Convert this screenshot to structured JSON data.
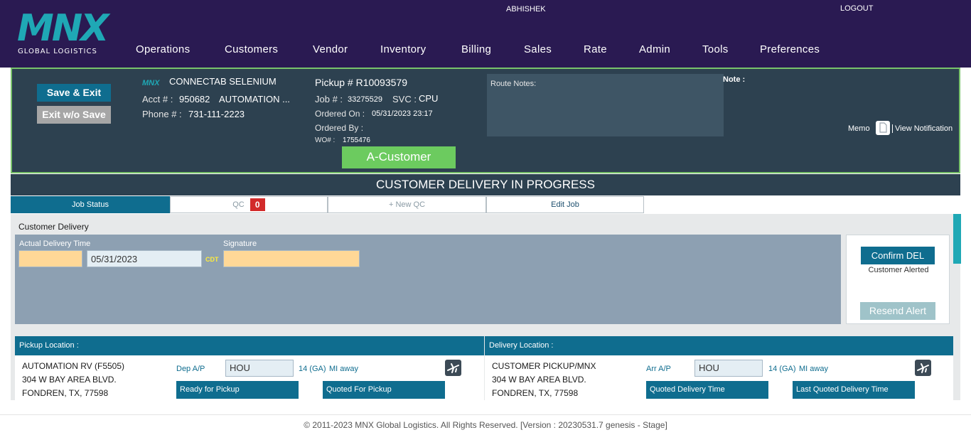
{
  "brand": {
    "logo": "MNX",
    "logo_sub": "GLOBAL LOGISTICS",
    "small_logo": "MNX"
  },
  "user": {
    "name": "ABHISHEK",
    "logout": "LOGOUT"
  },
  "nav": [
    {
      "label": "Operations"
    },
    {
      "label": "Customers"
    },
    {
      "label": "Vendor"
    },
    {
      "label": "Inventory"
    },
    {
      "label": "Billing"
    },
    {
      "label": "Sales"
    },
    {
      "label": "Rate"
    },
    {
      "label": "Admin"
    },
    {
      "label": "Tools"
    },
    {
      "label": "Preferences"
    }
  ],
  "header": {
    "save_exit": "Save & Exit",
    "exit_no_save": "Exit w/o Save",
    "customer_name": "CONNECTAB SELENIUM",
    "acct_label": "Acct # :",
    "acct_no": "950682",
    "acct_name": "AUTOMATION ...",
    "phone_label": "Phone # :",
    "phone": "731-111-2223",
    "pickup_no": "Pickup # R10093579",
    "job_label": "Job # :",
    "job_no": "33275529",
    "svc_label": "SVC :",
    "svc": "CPU",
    "ordered_on_label": "Ordered On :",
    "ordered_on": "05/31/2023 23:17",
    "ordered_by_label": "Ordered By :",
    "wo_label": "WO# :",
    "wo_no": "1755476",
    "route_notes_label": "Route Notes:",
    "note_label": "Note :",
    "a_customer": "A-Customer",
    "memo": "Memo",
    "view_notification": "View Notification"
  },
  "status": "CUSTOMER DELIVERY IN PROGRESS",
  "tabs": {
    "job_status": "Job Status",
    "qc": "QC",
    "qc_count": "0",
    "new_qc": "+ New QC",
    "edit_job": "Edit Job"
  },
  "delivery": {
    "section_title": "Customer Delivery",
    "actual_time_label": "Actual Delivery Time",
    "actual_time_value": "",
    "date_value": "05/31/2023",
    "tz": "CDT",
    "signature_label": "Signature",
    "signature_value": "",
    "confirm": "Confirm DEL",
    "customer_alerted": "Customer Alerted",
    "resend": "Resend Alert"
  },
  "pickup": {
    "title": "Pickup Location :",
    "line1": "AUTOMATION RV (F5505)",
    "line2": "304 W BAY AREA BLVD.",
    "line3": "FONDREN, TX, 77598",
    "ap_label": "Dep A/P",
    "airport": "HOU",
    "distance": "14 (GA)",
    "mi_away": "MI away",
    "col1": "Ready for Pickup",
    "col2": "Quoted For Pickup"
  },
  "delivery_loc": {
    "title": "Delivery Location :",
    "line1": "CUSTOMER PICKUP/MNX",
    "line2": "304 W BAY AREA BLVD.",
    "line3": "FONDREN, TX, 77598",
    "ap_label": "Arr A/P",
    "airport": "HOU",
    "distance": "14 (GA)",
    "mi_away": "MI away",
    "col1": "Quoted Delivery Time",
    "col2": "Last Quoted Delivery Time"
  },
  "footer": "© 2011-2023 MNX Global Logistics. All Rights Reserved. [Version : 20230531.7 genesis - Stage]",
  "colors": {
    "nav_bg": "#2a1a52",
    "panel_bg": "#2d4150",
    "accent": "#0f6d8f",
    "brand": "#1fa8b5",
    "green": "#6ccb5f",
    "badge": "#d22b2b"
  },
  "icons": [
    "memo-doc-icon",
    "plane-icon"
  ]
}
